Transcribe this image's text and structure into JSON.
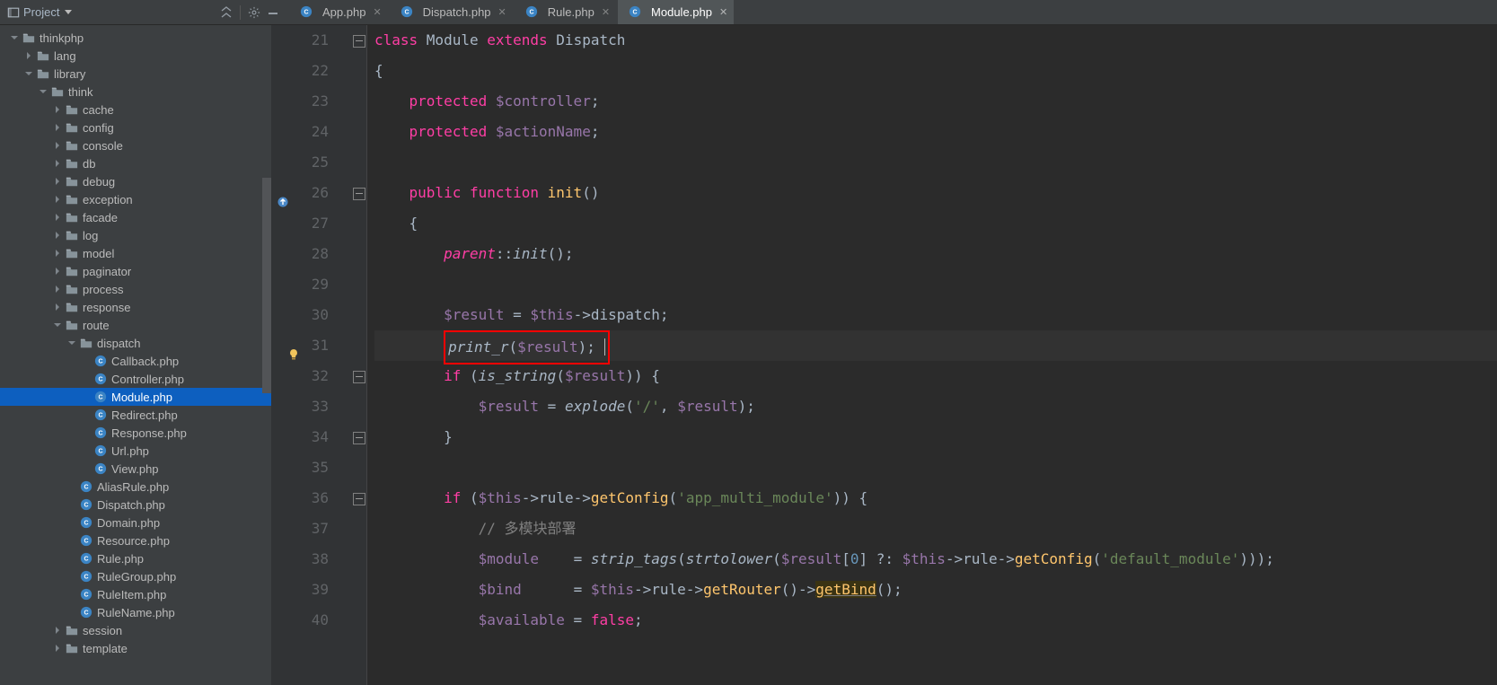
{
  "toolbar": {
    "project_label": "Project"
  },
  "tabs": [
    {
      "label": "App.php",
      "icon": "php",
      "active": false
    },
    {
      "label": "Dispatch.php",
      "icon": "php",
      "active": false
    },
    {
      "label": "Rule.php",
      "icon": "php",
      "active": false
    },
    {
      "label": "Module.php",
      "icon": "php",
      "active": true
    }
  ],
  "tree": [
    {
      "depth": 0,
      "chev": "open",
      "icon": "folder",
      "label": "thinkphp"
    },
    {
      "depth": 1,
      "chev": "closed",
      "icon": "folder",
      "label": "lang"
    },
    {
      "depth": 1,
      "chev": "open",
      "icon": "folder",
      "label": "library"
    },
    {
      "depth": 2,
      "chev": "open",
      "icon": "folder",
      "label": "think"
    },
    {
      "depth": 3,
      "chev": "closed",
      "icon": "folder",
      "label": "cache"
    },
    {
      "depth": 3,
      "chev": "closed",
      "icon": "folder",
      "label": "config"
    },
    {
      "depth": 3,
      "chev": "closed",
      "icon": "folder",
      "label": "console"
    },
    {
      "depth": 3,
      "chev": "closed",
      "icon": "folder",
      "label": "db"
    },
    {
      "depth": 3,
      "chev": "closed",
      "icon": "folder",
      "label": "debug"
    },
    {
      "depth": 3,
      "chev": "closed",
      "icon": "folder",
      "label": "exception"
    },
    {
      "depth": 3,
      "chev": "closed",
      "icon": "folder",
      "label": "facade"
    },
    {
      "depth": 3,
      "chev": "closed",
      "icon": "folder",
      "label": "log"
    },
    {
      "depth": 3,
      "chev": "closed",
      "icon": "folder",
      "label": "model"
    },
    {
      "depth": 3,
      "chev": "closed",
      "icon": "folder",
      "label": "paginator"
    },
    {
      "depth": 3,
      "chev": "closed",
      "icon": "folder",
      "label": "process"
    },
    {
      "depth": 3,
      "chev": "closed",
      "icon": "folder",
      "label": "response"
    },
    {
      "depth": 3,
      "chev": "open",
      "icon": "folder",
      "label": "route"
    },
    {
      "depth": 4,
      "chev": "open",
      "icon": "folder",
      "label": "dispatch"
    },
    {
      "depth": 5,
      "chev": "none",
      "icon": "php",
      "label": "Callback.php"
    },
    {
      "depth": 5,
      "chev": "none",
      "icon": "php",
      "label": "Controller.php"
    },
    {
      "depth": 5,
      "chev": "none",
      "icon": "php",
      "label": "Module.php",
      "selected": true
    },
    {
      "depth": 5,
      "chev": "none",
      "icon": "php",
      "label": "Redirect.php"
    },
    {
      "depth": 5,
      "chev": "none",
      "icon": "php",
      "label": "Response.php"
    },
    {
      "depth": 5,
      "chev": "none",
      "icon": "php",
      "label": "Url.php"
    },
    {
      "depth": 5,
      "chev": "none",
      "icon": "php",
      "label": "View.php"
    },
    {
      "depth": 4,
      "chev": "none",
      "icon": "php",
      "label": "AliasRule.php"
    },
    {
      "depth": 4,
      "chev": "none",
      "icon": "php",
      "label": "Dispatch.php"
    },
    {
      "depth": 4,
      "chev": "none",
      "icon": "php",
      "label": "Domain.php"
    },
    {
      "depth": 4,
      "chev": "none",
      "icon": "php",
      "label": "Resource.php"
    },
    {
      "depth": 4,
      "chev": "none",
      "icon": "php",
      "label": "Rule.php"
    },
    {
      "depth": 4,
      "chev": "none",
      "icon": "php",
      "label": "RuleGroup.php"
    },
    {
      "depth": 4,
      "chev": "none",
      "icon": "php",
      "label": "RuleItem.php"
    },
    {
      "depth": 4,
      "chev": "none",
      "icon": "php",
      "label": "RuleName.php"
    },
    {
      "depth": 3,
      "chev": "closed",
      "icon": "folder",
      "label": "session"
    },
    {
      "depth": 3,
      "chev": "closed",
      "icon": "folder",
      "label": "template"
    }
  ],
  "editor": {
    "first_line_no": 21,
    "lines": [
      {
        "no": 21,
        "tokens": [
          [
            "mg",
            "class "
          ],
          [
            "dk",
            "Module "
          ],
          [
            "mg",
            "extends "
          ],
          [
            "dk",
            "Dispatch"
          ]
        ]
      },
      {
        "no": 22,
        "tokens": [
          [
            "br",
            "{"
          ]
        ]
      },
      {
        "no": 23,
        "tokens": [
          [
            "sp",
            "    "
          ],
          [
            "mg",
            "protected "
          ],
          [
            "v",
            "$controller"
          ],
          [
            "op",
            ";"
          ]
        ]
      },
      {
        "no": 24,
        "tokens": [
          [
            "sp",
            "    "
          ],
          [
            "mg",
            "protected "
          ],
          [
            "v",
            "$actionName"
          ],
          [
            "op",
            ";"
          ]
        ]
      },
      {
        "no": 25,
        "tokens": []
      },
      {
        "no": 26,
        "gmark": "override",
        "fold": true,
        "tokens": [
          [
            "sp",
            "    "
          ],
          [
            "mg",
            "public function "
          ],
          [
            "fn",
            "init"
          ],
          [
            "br",
            "()"
          ]
        ]
      },
      {
        "no": 27,
        "tokens": [
          [
            "sp",
            "    "
          ],
          [
            "br",
            "{"
          ]
        ]
      },
      {
        "no": 28,
        "tokens": [
          [
            "sp",
            "        "
          ],
          [
            "it-mg",
            "parent"
          ],
          [
            "op",
            "::"
          ],
          [
            "it",
            "init"
          ],
          [
            "br",
            "();"
          ]
        ]
      },
      {
        "no": 29,
        "tokens": []
      },
      {
        "no": 30,
        "tokens": [
          [
            "sp",
            "        "
          ],
          [
            "v",
            "$result"
          ],
          [
            "op",
            " = "
          ],
          [
            "v",
            "$this"
          ],
          [
            "op",
            "->"
          ],
          [
            "dk",
            "dispatch"
          ],
          [
            "op",
            ";"
          ]
        ]
      },
      {
        "no": 31,
        "gmark": "bulb",
        "hl": true,
        "boxed": true,
        "tokens": [
          [
            "sp",
            "        "
          ],
          [
            "it",
            "print_r"
          ],
          [
            "br",
            "("
          ],
          [
            "v",
            "$result"
          ],
          [
            "br",
            ")"
          ],
          [
            "op",
            ";"
          ]
        ],
        "cursor": true
      },
      {
        "no": 32,
        "fold": true,
        "tokens": [
          [
            "sp",
            "        "
          ],
          [
            "mg",
            "if "
          ],
          [
            "br",
            "("
          ],
          [
            "it",
            "is_string"
          ],
          [
            "br",
            "("
          ],
          [
            "v",
            "$result"
          ],
          [
            "br",
            ")) {"
          ]
        ]
      },
      {
        "no": 33,
        "tokens": [
          [
            "sp",
            "            "
          ],
          [
            "v",
            "$result"
          ],
          [
            "op",
            " = "
          ],
          [
            "it",
            "explode"
          ],
          [
            "br",
            "("
          ],
          [
            "s",
            "'/'"
          ],
          [
            "op",
            ", "
          ],
          [
            "v",
            "$result"
          ],
          [
            "br",
            ");"
          ]
        ]
      },
      {
        "no": 34,
        "foldend": true,
        "tokens": [
          [
            "sp",
            "        "
          ],
          [
            "br",
            "}"
          ]
        ]
      },
      {
        "no": 35,
        "tokens": []
      },
      {
        "no": 36,
        "fold": true,
        "tokens": [
          [
            "sp",
            "        "
          ],
          [
            "mg",
            "if "
          ],
          [
            "br",
            "("
          ],
          [
            "v",
            "$this"
          ],
          [
            "op",
            "->"
          ],
          [
            "dk",
            "rule"
          ],
          [
            "op",
            "->"
          ],
          [
            "fn",
            "getConfig"
          ],
          [
            "br",
            "("
          ],
          [
            "s",
            "'app_multi_module'"
          ],
          [
            "br",
            ")) {"
          ]
        ]
      },
      {
        "no": 37,
        "tokens": [
          [
            "sp",
            "            "
          ],
          [
            "c",
            "// 多模块部署"
          ]
        ]
      },
      {
        "no": 38,
        "tokens": [
          [
            "sp",
            "            "
          ],
          [
            "v",
            "$module"
          ],
          [
            "op",
            "    = "
          ],
          [
            "it",
            "strip_tags"
          ],
          [
            "br",
            "("
          ],
          [
            "it",
            "strtolower"
          ],
          [
            "br",
            "("
          ],
          [
            "v",
            "$result"
          ],
          [
            "br",
            "["
          ],
          [
            "n",
            "0"
          ],
          [
            "br",
            "] "
          ],
          [
            "op",
            "?: "
          ],
          [
            "v",
            "$this"
          ],
          [
            "op",
            "->"
          ],
          [
            "dk",
            "rule"
          ],
          [
            "op",
            "->"
          ],
          [
            "fn",
            "getConfig"
          ],
          [
            "br",
            "("
          ],
          [
            "s",
            "'default_module'"
          ],
          [
            "br",
            ")));"
          ]
        ]
      },
      {
        "no": 39,
        "tokens": [
          [
            "sp",
            "            "
          ],
          [
            "v",
            "$bind"
          ],
          [
            "op",
            "      = "
          ],
          [
            "v",
            "$this"
          ],
          [
            "op",
            "->"
          ],
          [
            "dk",
            "rule"
          ],
          [
            "op",
            "->"
          ],
          [
            "fn",
            "getRouter"
          ],
          [
            "br",
            "()->"
          ],
          [
            "uline-fn",
            "getBind"
          ],
          [
            "br",
            "();"
          ]
        ]
      },
      {
        "no": 40,
        "tokens": [
          [
            "sp",
            "            "
          ],
          [
            "v",
            "$available"
          ],
          [
            "op",
            " = "
          ],
          [
            "mg",
            "false"
          ],
          [
            "op",
            ";"
          ]
        ]
      }
    ]
  }
}
